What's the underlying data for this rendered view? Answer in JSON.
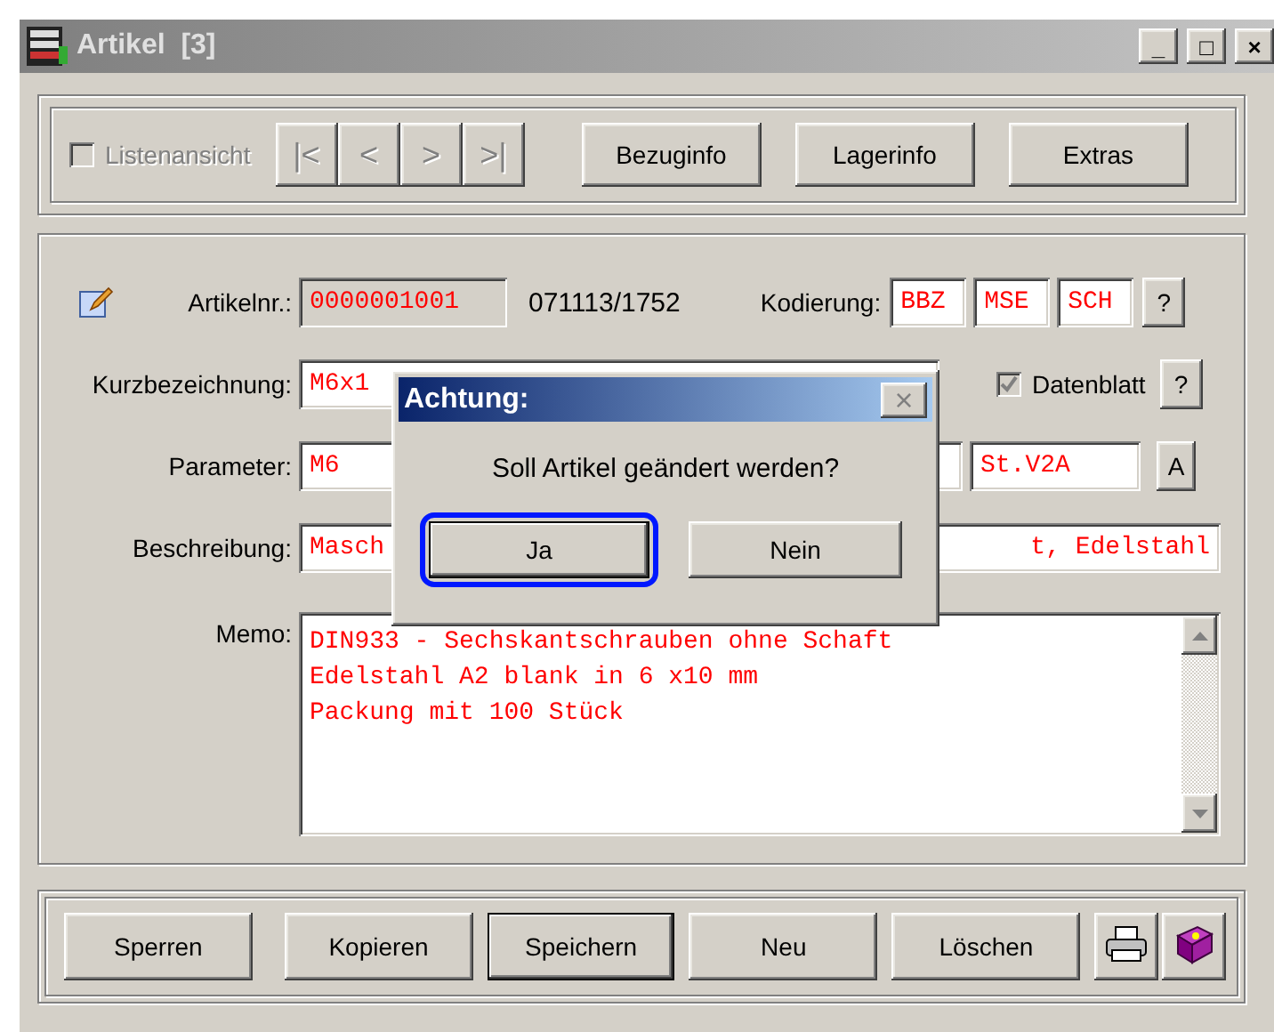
{
  "window": {
    "title": "Artikel  [3]",
    "controls": [
      "_",
      "□",
      "×"
    ]
  },
  "toolbar": {
    "list_view": {
      "label": "Listenansicht",
      "checked": false,
      "disabled": true
    },
    "nav_buttons": [
      {
        "label": "|<",
        "disabled": true
      },
      {
        "label": "<",
        "disabled": true
      },
      {
        "label": ">",
        "disabled": true
      },
      {
        "label": ">|",
        "disabled": true
      }
    ],
    "buttons": [
      "Bezuginfo",
      "Lagerinfo",
      "Extras"
    ]
  },
  "form": {
    "article_no": {
      "label": "Artikelnr.:",
      "value": "0000001001"
    },
    "timestamp": "071113/1752",
    "coding": {
      "label": "Kodierung:",
      "codes": [
        "BBZ",
        "MSE",
        "SCH"
      ],
      "help": "?"
    },
    "short_name": {
      "label": "Kurzbezeichnung:",
      "value": "M6x1"
    },
    "datasheet": {
      "label": "Datenblatt",
      "checked": true,
      "disabled": true,
      "help": "?"
    },
    "parameter": {
      "label": "Parameter:",
      "value": "M6",
      "material": "St.V2A",
      "button": "A"
    },
    "description": {
      "label": "Beschreibung:",
      "visible_start": "Masch",
      "visible_end": "t, Edelstahl"
    },
    "memo": {
      "label": "Memo:",
      "lines": [
        "DIN933 - Sechskantschrauben ohne Schaft",
        "Edelstahl A2 blank in 6 x10 mm",
        "Packung mit 100 Stück"
      ]
    }
  },
  "footer": {
    "buttons": [
      {
        "label": "Sperren",
        "default": false
      },
      {
        "label": "Kopieren",
        "default": false
      },
      {
        "label": "Speichern",
        "default": true
      },
      {
        "label": "Neu",
        "default": false
      },
      {
        "label": "Löschen",
        "default": false
      }
    ]
  },
  "dialog": {
    "title": "Achtung:",
    "close": "×",
    "message": "Soll Artikel geändert werden?",
    "buttons": [
      {
        "label": "Ja",
        "focused": true
      },
      {
        "label": "Nein",
        "focused": false
      }
    ]
  }
}
